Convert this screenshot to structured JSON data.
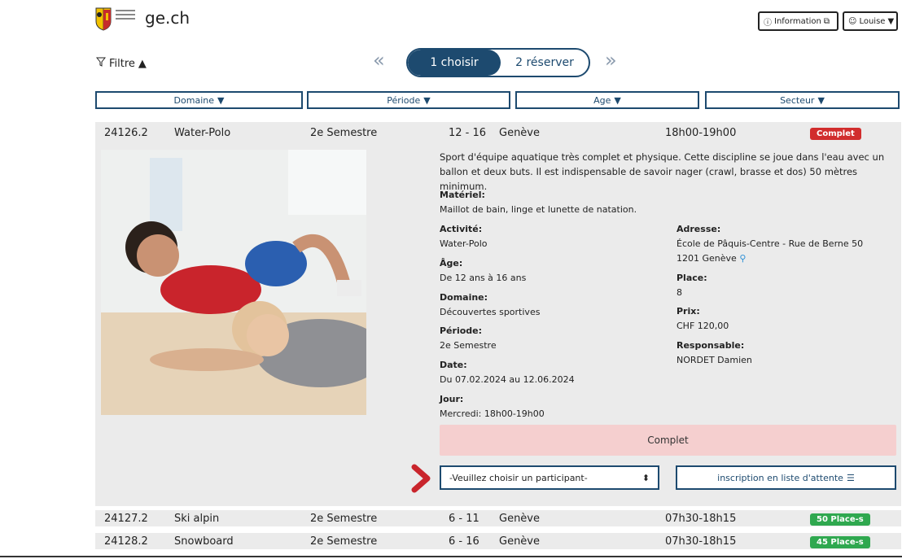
{
  "header": {
    "site_name": "ge.ch",
    "info_button": "Information",
    "user_button": "Louise"
  },
  "filter": {
    "label": "Filtre"
  },
  "steps": {
    "step1": "1 choisir",
    "step2": "2 réserver"
  },
  "columns": [
    "Domaine",
    "Période",
    "Age",
    "Secteur"
  ],
  "activity": {
    "code": "24126.2",
    "name": "Water-Polo",
    "semester": "2e Semestre",
    "ages": "12 - 16",
    "city": "Genève",
    "hours": "18h00-19h00",
    "status": "Complet",
    "description": "Sport d'équipe aquatique très complet et physique. Cette discipline se joue dans l'eau avec un ballon et deux buts. Il est indispensable de savoir nager (crawl, brasse et dos) 50 mètres minimum.",
    "materiel_label": "Matériel:",
    "materiel": "Maillot de bain, linge et lunette de natation.",
    "activite_label": "Activité:",
    "activite": "Water-Polo",
    "age_label": "Âge:",
    "age": "De 12 ans à 16 ans",
    "domaine_label": "Domaine:",
    "domaine": "Découvertes sportives",
    "periode_label": "Période:",
    "periode": "2e Semestre",
    "date_label": "Date:",
    "date": "Du 07.02.2024 au 12.06.2024",
    "jour_label": "Jour:",
    "jour": "Mercredi: 18h00-19h00",
    "adresse_label": "Adresse:",
    "adresse1": "École de Pâquis-Centre - Rue de Berne 50",
    "adresse2": "1201 Genève",
    "place_label": "Place:",
    "place": "8",
    "prix_label": "Prix:",
    "prix": "CHF 120,00",
    "responsable_label": "Responsable:",
    "responsable": "NORDET Damien",
    "complet_bar": "Complet",
    "select_placeholder": "-Veuillez choisir un participant-",
    "waitlist_button": "inscription en liste d'attente"
  },
  "rows": [
    {
      "code": "24127.2",
      "name": "Ski alpin",
      "semester": "2e Semestre",
      "ages": "6 - 11",
      "city": "Genève",
      "hours": "07h30-18h15",
      "status": "50 Place-s"
    },
    {
      "code": "24128.2",
      "name": "Snowboard",
      "semester": "2e Semestre",
      "ages": "6 - 16",
      "city": "Genève",
      "hours": "07h30-18h15",
      "status": "45 Place-s"
    }
  ],
  "colors": {
    "accent": "#1d4a6f",
    "complet": "#d12d2d",
    "places": "#2fa84f",
    "complet_bar_bg": "#f5cfcf"
  }
}
